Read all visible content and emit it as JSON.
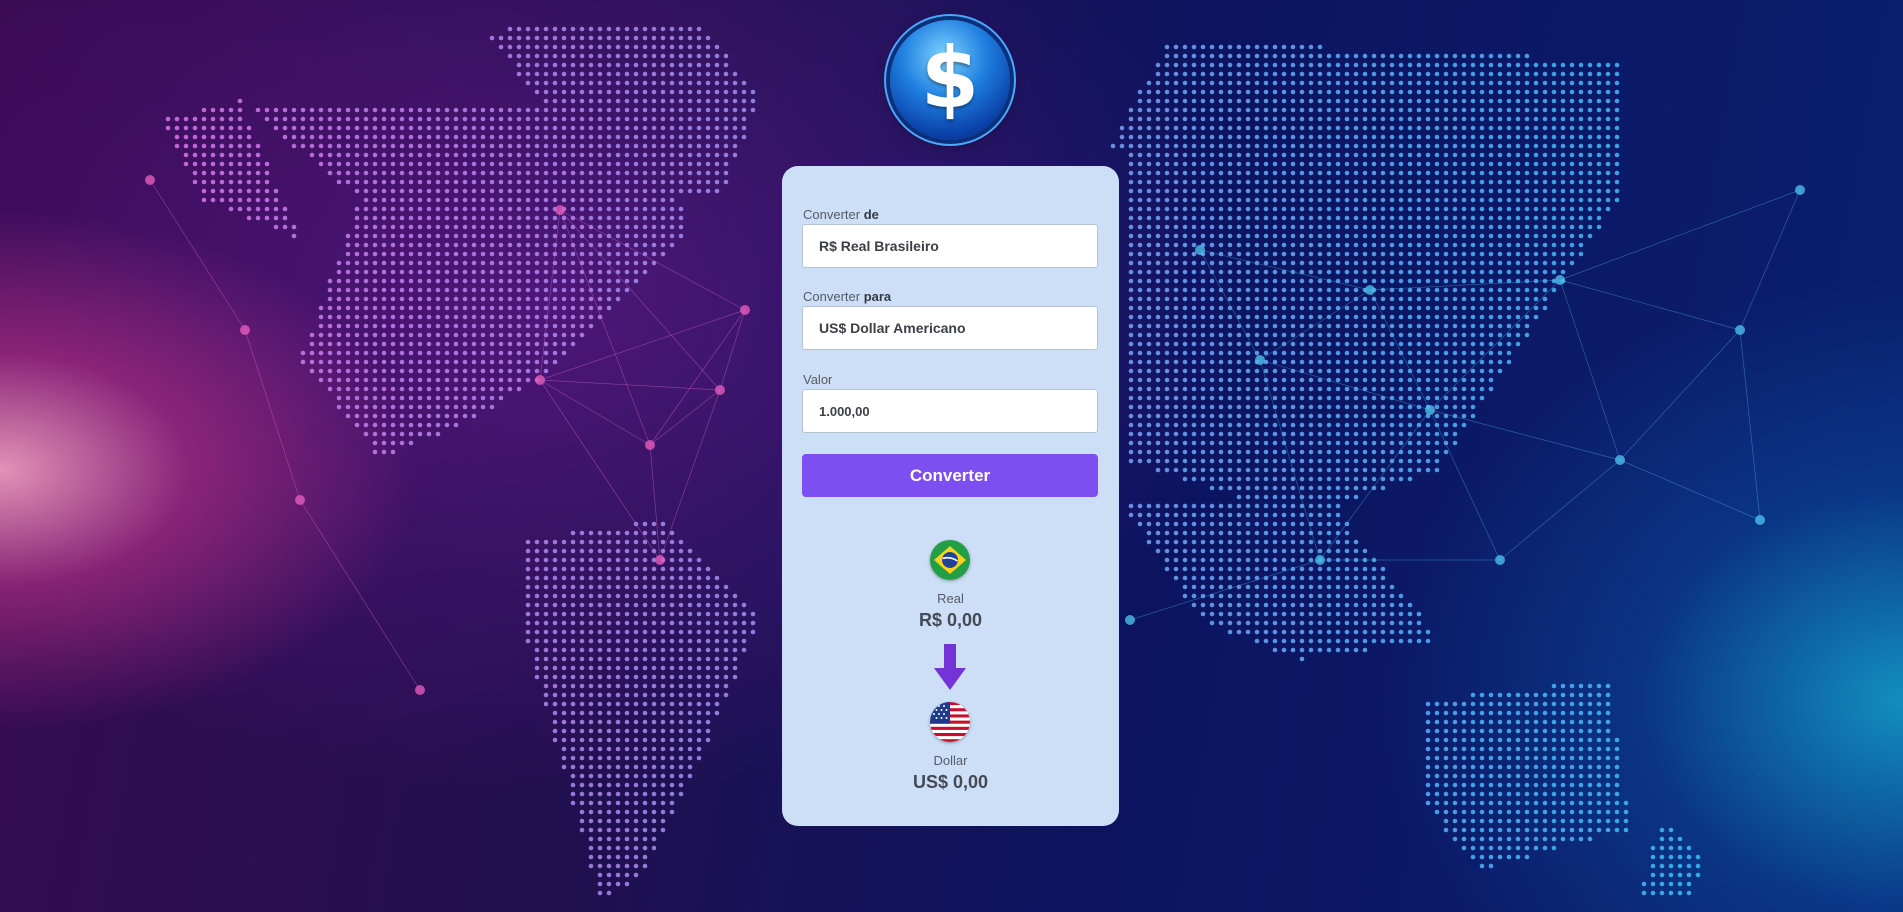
{
  "logo": {
    "symbol": "$"
  },
  "form": {
    "from": {
      "label_prefix": "Converter",
      "label_bold": "de",
      "value": "R$ Real Brasileiro"
    },
    "to": {
      "label_prefix": "Converter",
      "label_bold": "para",
      "value": "US$ Dollar Americano"
    },
    "amount": {
      "label": "Valor",
      "value": "1.000,00"
    },
    "convert_label": "Converter"
  },
  "result": {
    "source": {
      "flag": "brazil-flag-icon",
      "name": "Real",
      "value": "R$ 0,00"
    },
    "target": {
      "flag": "usa-flag-icon",
      "name": "Dollar",
      "value": "US$ 0,00"
    }
  },
  "colors": {
    "accent": "#7d4ef0",
    "card": "#cddff6",
    "arrow": "#7433d6"
  }
}
